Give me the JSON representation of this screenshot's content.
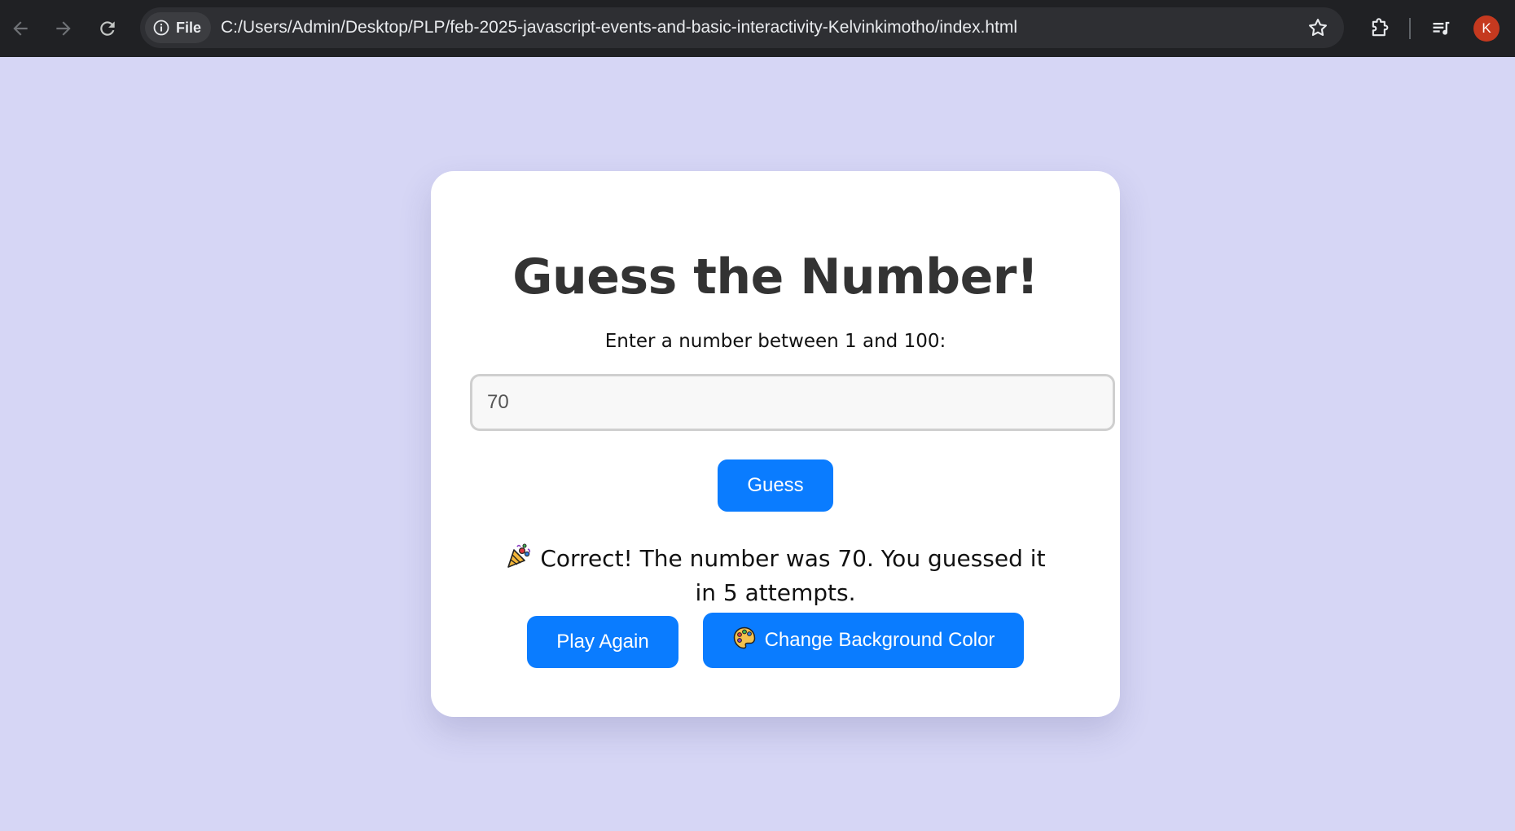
{
  "browser": {
    "site_chip_label": "File",
    "url": "C:/Users/Admin/Desktop/PLP/feb-2025-javascript-events-and-basic-interactivity-Kelvinkimotho/index.html",
    "profile_initial": "K"
  },
  "page": {
    "title": "Guess the Number!",
    "prompt": "Enter a number between 1 and 100:",
    "input_value": "70",
    "guess_label": "Guess",
    "result_text": "Correct! The number was 70. You guessed it in 5 attempts.",
    "play_again_label": "Play Again",
    "change_bg_label": "Change Background Color"
  },
  "colors": {
    "page_background": "#d6d6f5",
    "button_blue": "#0a7cff",
    "chrome_dark": "#202124"
  },
  "icons": {
    "result_icon": "party-popper",
    "change_bg_icon": "artist-palette"
  }
}
